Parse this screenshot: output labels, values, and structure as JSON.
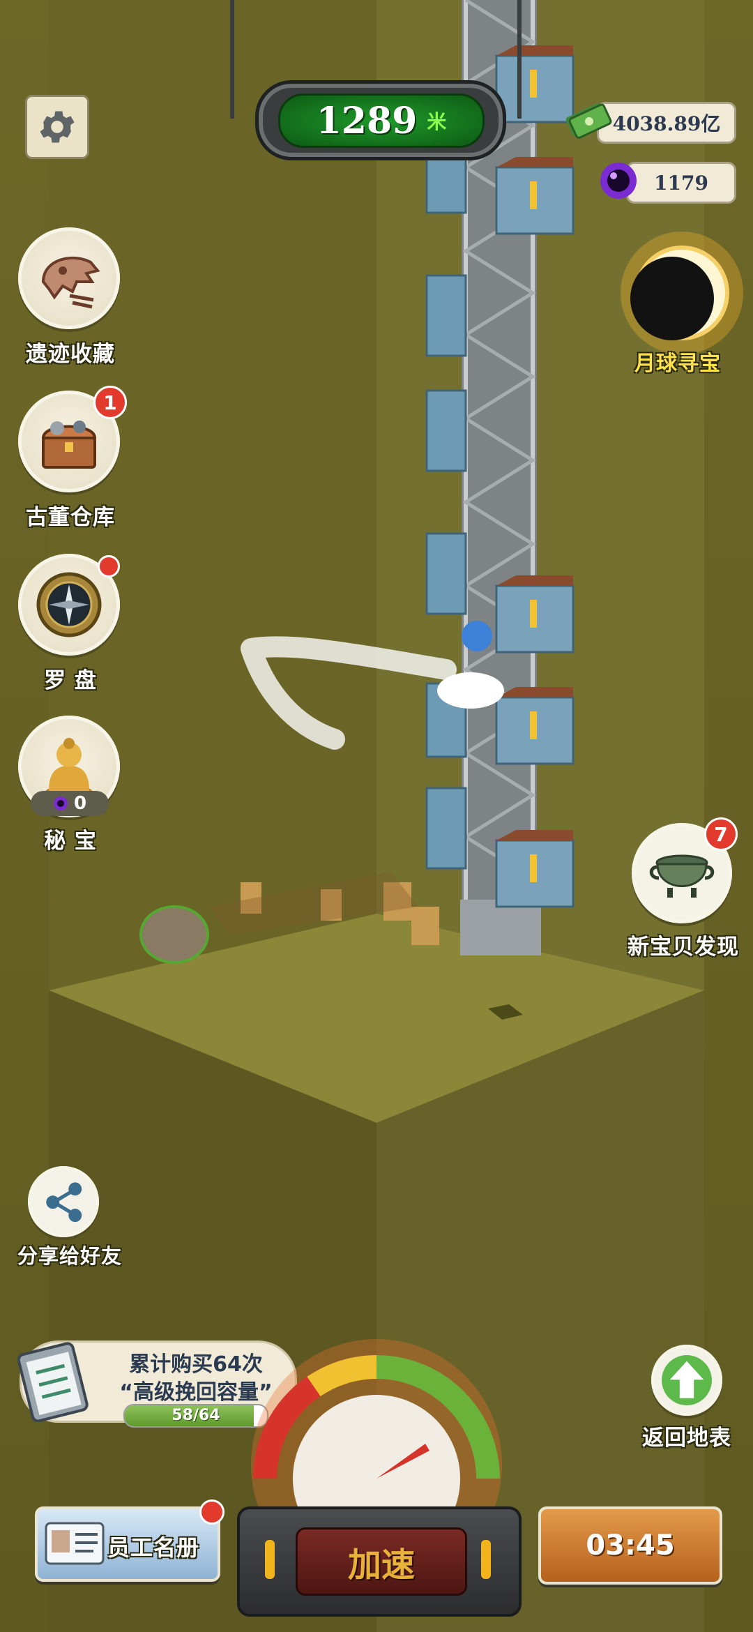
{
  "hud": {
    "depth_value": "1289",
    "depth_unit": "米",
    "money": "4038.89亿",
    "dark_gems": "1179",
    "moon_label": "月球寻宝"
  },
  "left_menu": [
    {
      "label": "遗迹收藏"
    },
    {
      "label": "古董仓库",
      "badge": "1"
    },
    {
      "label": "罗 盘"
    },
    {
      "label": "秘 宝",
      "count": "0"
    }
  ],
  "right_menu": {
    "new_treasure_label": "新宝贝发现",
    "new_treasure_badge": "7",
    "return_label": "返回地表"
  },
  "share": {
    "label": "分享给好友"
  },
  "purchase": {
    "line1": "累计购买64次",
    "line2": "“高级挽回容量”",
    "progress_text": "58/64",
    "progress_current": 58,
    "progress_total": 64
  },
  "bottom": {
    "staff_label": "员工名册",
    "speed_label": "加速",
    "timer": "03:45"
  }
}
